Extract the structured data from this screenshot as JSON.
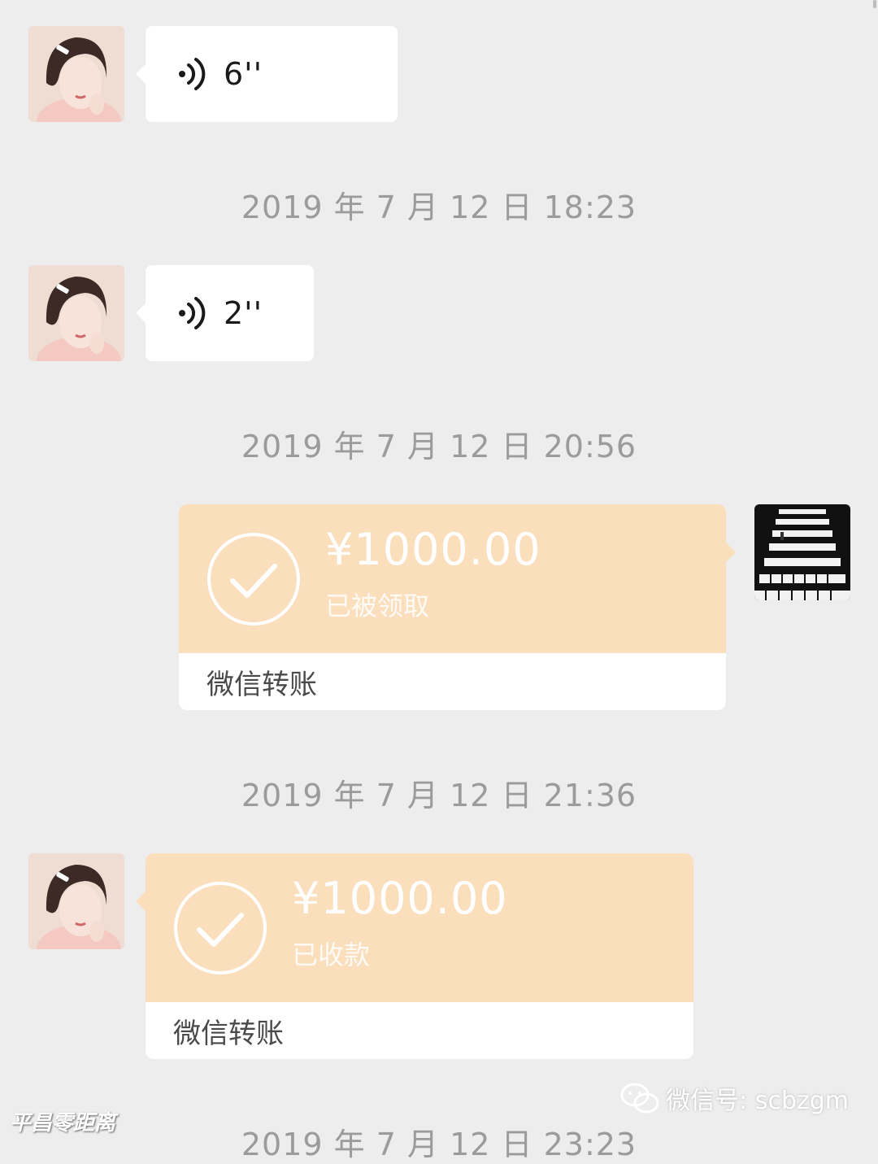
{
  "colors": {
    "background": "#ededed",
    "transfer_card": "#fbdfbd",
    "bubble": "#ffffff",
    "timestamp_text": "#9b9b9b"
  },
  "messages": {
    "voice1": {
      "icon": "voice-wave-icon",
      "duration": "6''"
    },
    "stamp1": "2019 年 7 月 12 日 18:23",
    "voice2": {
      "icon": "voice-wave-icon",
      "duration": "2''"
    },
    "stamp2": "2019 年 7 月 12 日 20:56",
    "transfer1": {
      "amount": "¥1000.00",
      "status": "已被领取",
      "label": "微信转账",
      "icon": "check-circle-icon"
    },
    "stamp3": "2019 年 7 月 12 日 21:36",
    "transfer2": {
      "amount": "¥1000.00",
      "status": "已收款",
      "label": "微信转账",
      "icon": "check-circle-icon"
    },
    "stamp4": "2019 年 7 月 12 日 23:23"
  },
  "watermark": {
    "account": "微信号: scbzgm",
    "brand": "平昌零距离"
  }
}
